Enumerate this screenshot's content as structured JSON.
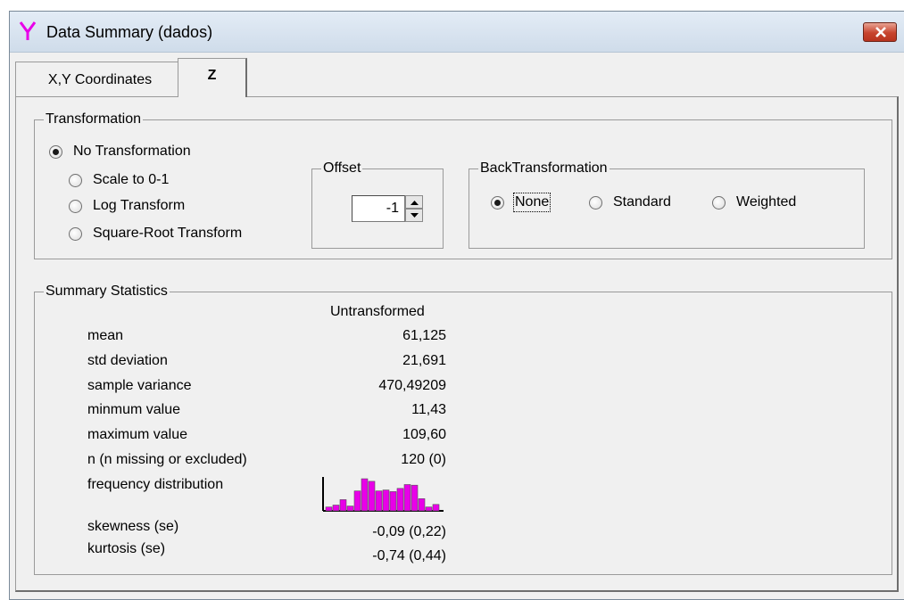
{
  "window": {
    "title": "Data Summary (dados)"
  },
  "tabs": [
    "X,Y Coordinates",
    "Z"
  ],
  "transformation": {
    "legend": "Transformation",
    "options": [
      "No Transformation",
      "Scale to 0-1",
      "Log Transform",
      "Square-Root Transform"
    ],
    "selected": "No Transformation"
  },
  "offset": {
    "legend": "Offset",
    "value": "-1"
  },
  "back_transformation": {
    "legend": "BackTransformation",
    "options": [
      "None",
      "Standard",
      "Weighted"
    ],
    "selected": "None"
  },
  "summary": {
    "legend": "Summary Statistics",
    "column_header": "Untransformed",
    "rows": [
      {
        "label": "mean",
        "value": "61,125"
      },
      {
        "label": "std deviation",
        "value": "21,691"
      },
      {
        "label": "sample variance",
        "value": "470,49209"
      },
      {
        "label": "minmum value",
        "value": "11,43"
      },
      {
        "label": "maximum value",
        "value": "109,60"
      },
      {
        "label": "n (n missing or excluded)",
        "value": "120 (0)"
      },
      {
        "label": "frequency distribution",
        "value": ""
      },
      {
        "label": "skewness (se)",
        "value": "-0,09 (0,22)"
      },
      {
        "label": "kurtosis (se)",
        "value": "-0,74 (0,44)"
      }
    ],
    "histogram": {
      "color": "#e800e8",
      "relative_heights": [
        0.12,
        0.18,
        0.35,
        0.15,
        0.62,
        1.0,
        0.92,
        0.62,
        0.65,
        0.6,
        0.7,
        0.82,
        0.8,
        0.38,
        0.12,
        0.2
      ]
    }
  },
  "colors": {
    "background": "#f0f0f0",
    "close_button": "#c7442e",
    "app_icon": "#e800e8"
  }
}
